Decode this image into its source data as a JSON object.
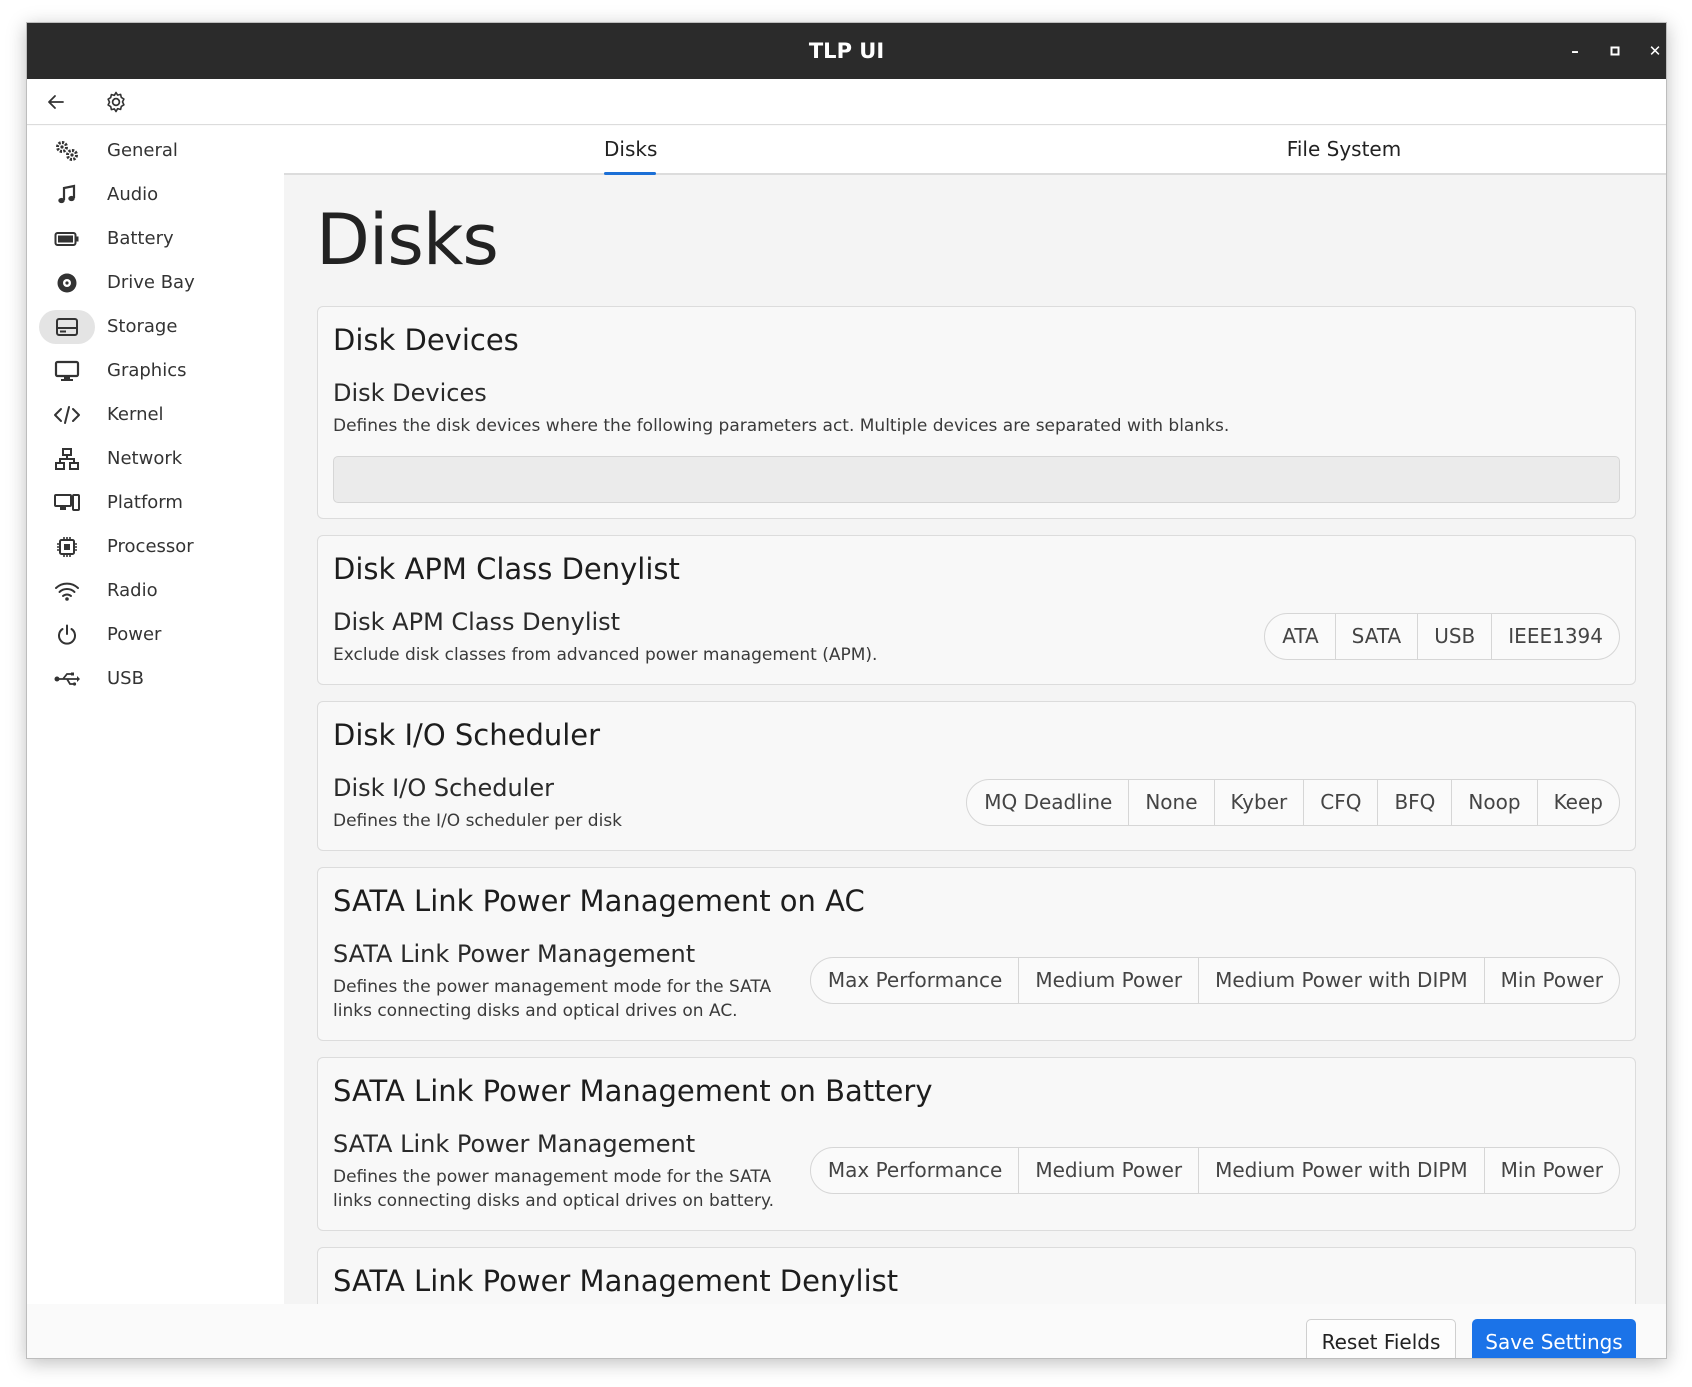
{
  "window": {
    "title": "TLP UI",
    "minimize": "–",
    "maximize": "▫",
    "close": "✕"
  },
  "toolbar": {
    "back_icon": "arrow-left-icon",
    "settings_icon": "gear-icon"
  },
  "sidebar": {
    "items": [
      {
        "label": "General",
        "icon": "gears-icon"
      },
      {
        "label": "Audio",
        "icon": "music-note-icon"
      },
      {
        "label": "Battery",
        "icon": "battery-icon"
      },
      {
        "label": "Drive Bay",
        "icon": "disc-icon"
      },
      {
        "label": "Storage",
        "icon": "hard-drive-icon",
        "active": true
      },
      {
        "label": "Graphics",
        "icon": "monitor-icon"
      },
      {
        "label": "Kernel",
        "icon": "code-icon"
      },
      {
        "label": "Network",
        "icon": "network-icon"
      },
      {
        "label": "Platform",
        "icon": "devices-icon"
      },
      {
        "label": "Processor",
        "icon": "cpu-chip-icon"
      },
      {
        "label": "Radio",
        "icon": "wifi-icon"
      },
      {
        "label": "Power",
        "icon": "power-icon"
      },
      {
        "label": "USB",
        "icon": "usb-icon"
      }
    ]
  },
  "tabs": [
    {
      "label": "Disks",
      "active": true
    },
    {
      "label": "File System",
      "active": false
    }
  ],
  "main": {
    "page_title": "Disks",
    "cards": [
      {
        "title": "Disk Devices",
        "label": "Disk Devices",
        "description": "Defines the disk devices where the following parameters act. Multiple devices are separated with blanks.",
        "input_value": ""
      },
      {
        "title": "Disk APM Class Denylist",
        "label": "Disk APM Class Denylist",
        "description": "Exclude disk classes from advanced power management (APM).",
        "options": [
          "ATA",
          "SATA",
          "USB",
          "IEEE1394"
        ]
      },
      {
        "title": "Disk I/O Scheduler",
        "label": "Disk I/O Scheduler",
        "description": "Defines the I/O scheduler per disk",
        "options": [
          "MQ Deadline",
          "None",
          "Kyber",
          "CFQ",
          "BFQ",
          "Noop",
          "Keep"
        ]
      },
      {
        "title": "SATA Link Power Management on AC",
        "label": "SATA Link Power Management",
        "description_line1": "Defines the power management mode for the SATA",
        "description_line2": "links connecting disks and optical drives on AC.",
        "options": [
          "Max Performance",
          "Medium Power",
          "Medium Power with DIPM",
          "Min Power"
        ]
      },
      {
        "title": "SATA Link Power Management on Battery",
        "label": "SATA Link Power Management",
        "description_line1": "Defines the power management mode for the SATA",
        "description_line2": "links connecting disks and optical drives on battery.",
        "options": [
          "Max Performance",
          "Medium Power",
          "Medium Power with DIPM",
          "Min Power"
        ]
      },
      {
        "title": "SATA Link Power Management Denylist"
      }
    ]
  },
  "footer": {
    "reset_label": "Reset Fields",
    "save_label": "Save Settings"
  },
  "colors": {
    "accent": "#1b73e8",
    "titlebar": "#2b2b2b"
  }
}
